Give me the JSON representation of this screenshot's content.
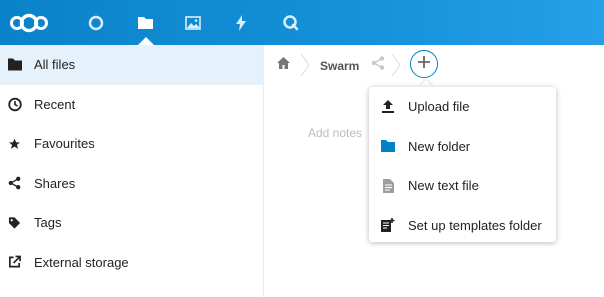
{
  "header": {
    "apps": [
      {
        "name": "dashboard",
        "icon": "circle-icon"
      },
      {
        "name": "files",
        "icon": "folder-icon",
        "active": true
      },
      {
        "name": "photos",
        "icon": "image-icon"
      },
      {
        "name": "activity",
        "icon": "lightning-icon"
      },
      {
        "name": "search",
        "icon": "search-icon"
      }
    ],
    "colors": {
      "start": "#0a82c9",
      "end": "#25a0e8"
    }
  },
  "sidebar": {
    "items": [
      {
        "label": "All files",
        "icon": "folder-icon",
        "active": true
      },
      {
        "label": "Recent",
        "icon": "clock-icon"
      },
      {
        "label": "Favourites",
        "icon": "star-icon"
      },
      {
        "label": "Shares",
        "icon": "share-icon"
      },
      {
        "label": "Tags",
        "icon": "tag-icon"
      },
      {
        "label": "External storage",
        "icon": "external-link-icon"
      }
    ]
  },
  "breadcrumb": {
    "items": [
      {
        "label": "",
        "icon": "home-icon"
      },
      {
        "label": "Swarm"
      }
    ]
  },
  "content": {
    "notes_placeholder": "Add notes"
  },
  "new_menu": {
    "items": [
      {
        "label": "Upload file",
        "icon": "upload-icon"
      },
      {
        "label": "New folder",
        "icon": "folder-icon"
      },
      {
        "label": "New text file",
        "icon": "text-file-icon"
      },
      {
        "label": "Set up templates folder",
        "icon": "templates-icon"
      }
    ]
  },
  "colors": {
    "accent": "#0082c9",
    "folder": "#0082c9",
    "active_bg": "#e6f2fb"
  }
}
